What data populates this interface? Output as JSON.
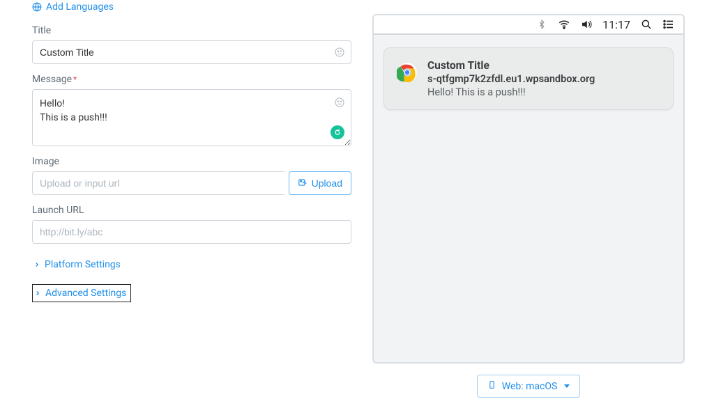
{
  "addLanguages": "Add Languages",
  "form": {
    "titleLabel": "Title",
    "titleValue": "Custom Title",
    "messageLabel": "Message",
    "messageValue": "Hello!\nThis is a push!!!",
    "imageLabel": "Image",
    "imagePlaceholder": "Upload or input url",
    "uploadLabel": "Upload",
    "launchUrlLabel": "Launch URL",
    "launchUrlPlaceholder": "http://bit.ly/abc",
    "platformSettings": "Platform Settings",
    "advancedSettings": "Advanced Settings"
  },
  "preview": {
    "menubarTime": "11:17",
    "notification": {
      "title": "Custom Title",
      "url": "s-qtfgmp7k2zfdl.eu1.wpsandbox.org",
      "message": "Hello! This is a push!!!"
    },
    "platformSelector": "Web: macOS"
  }
}
